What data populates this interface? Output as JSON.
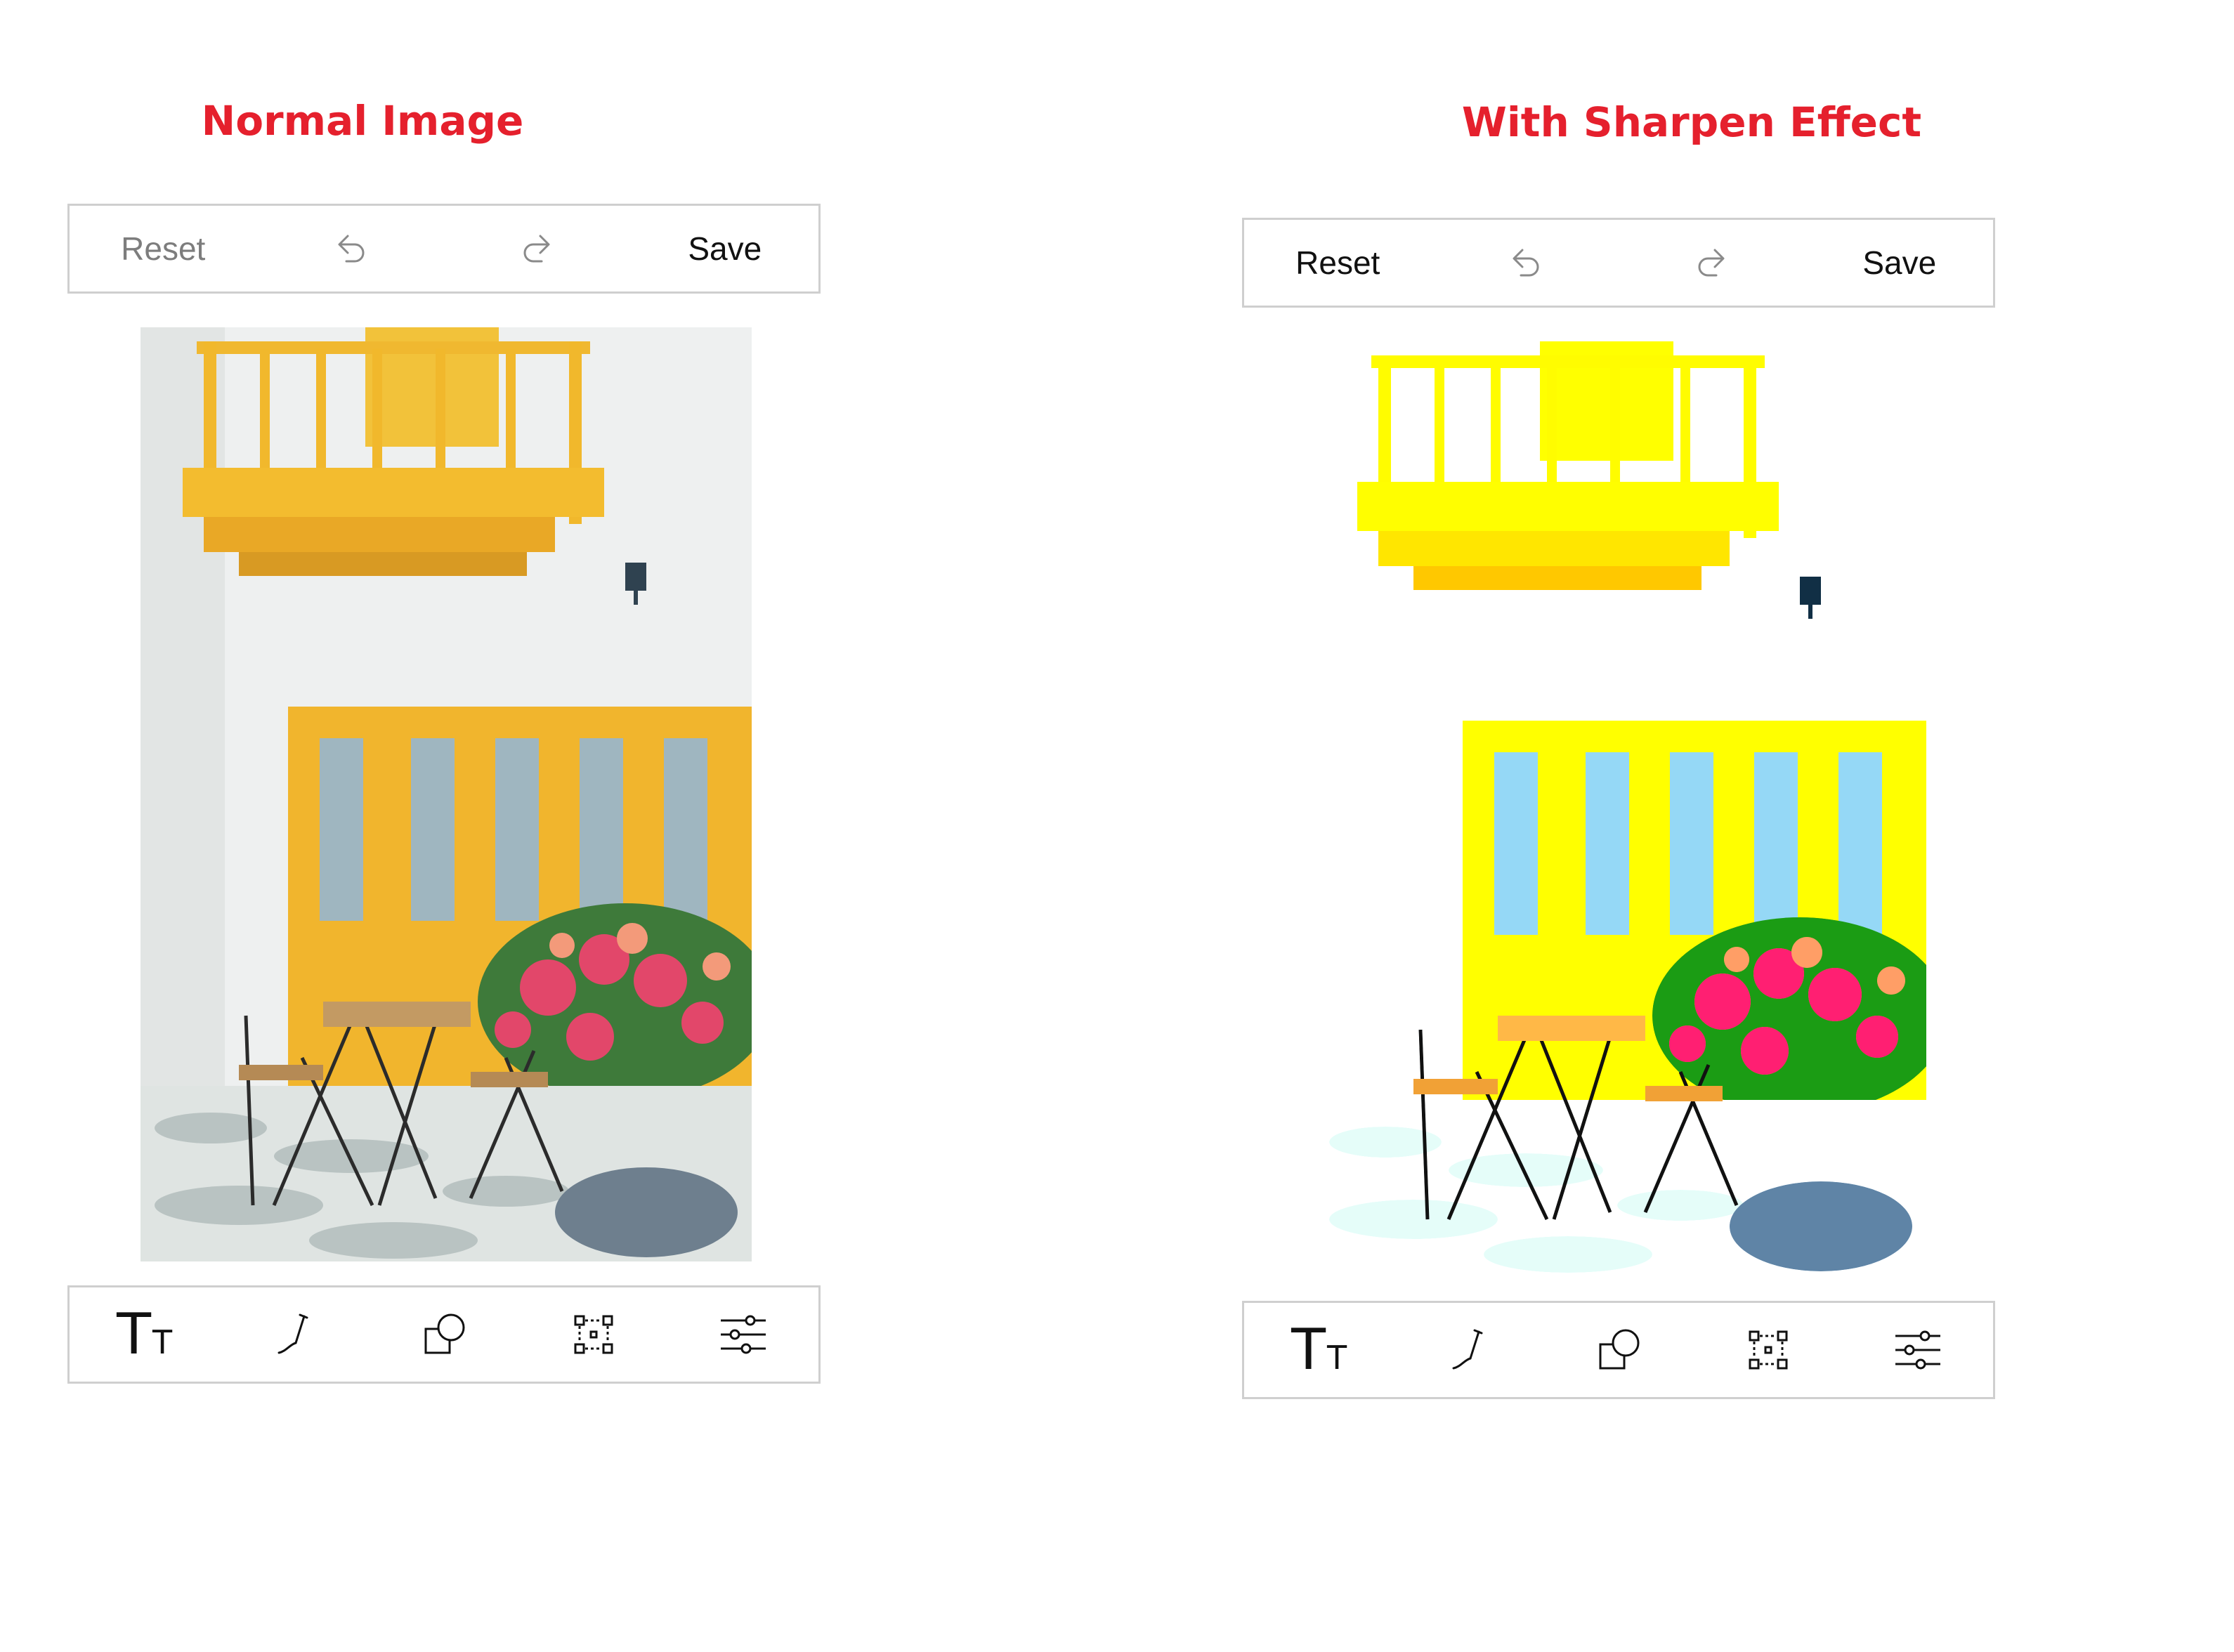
{
  "panels": [
    {
      "caption": "Normal Image",
      "toolbar": {
        "reset": "Reset",
        "save": "Save",
        "reset_enabled": false
      },
      "tools": [
        "text-icon",
        "pen-icon",
        "shapes-icon",
        "crop-transform-icon",
        "adjust-sliders-icon"
      ],
      "image": "balcony-yellow-doors-flowers-bistro-chairs"
    },
    {
      "caption": "With  Sharpen Effect",
      "toolbar": {
        "reset": "Reset",
        "save": "Save",
        "reset_enabled": true
      },
      "tools": [
        "text-icon",
        "pen-icon",
        "shapes-icon",
        "crop-transform-icon",
        "adjust-sliders-icon"
      ],
      "image": "balcony-yellow-doors-flowers-bistro-chairs-sharpened"
    }
  ],
  "colors": {
    "caption": "#e5202d",
    "toolbar_border": "#cfcfcf",
    "accent_yellow": "#f2b82f"
  },
  "text_tool_glyphs": {
    "big": "T",
    "small": "T"
  }
}
